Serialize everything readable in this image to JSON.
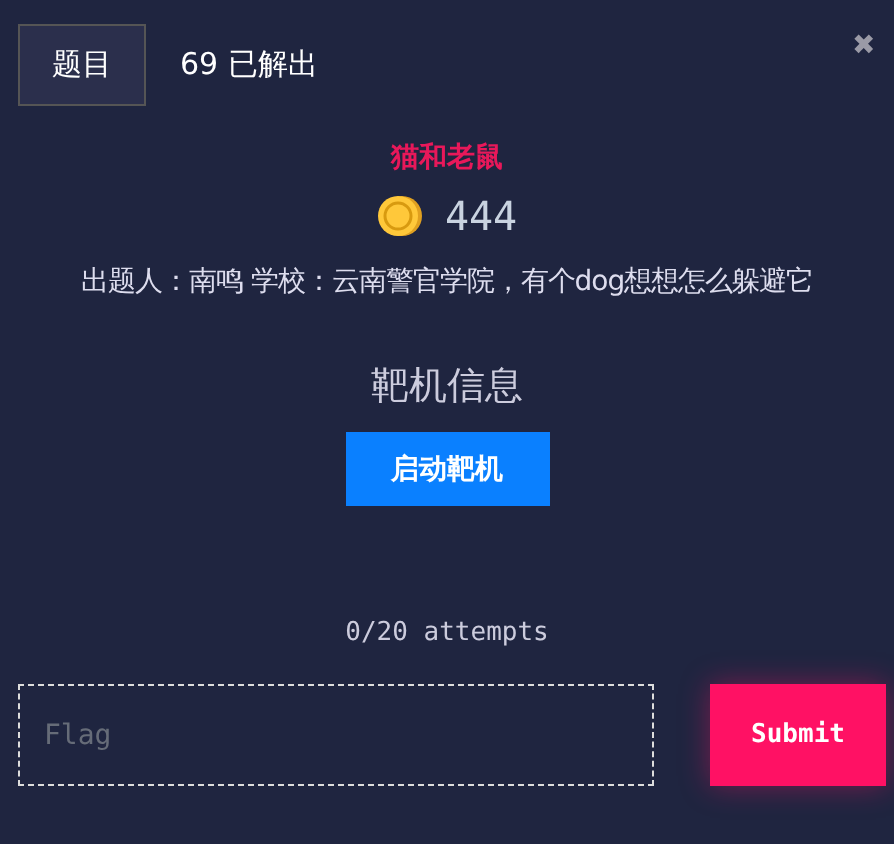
{
  "tabs": [
    {
      "label": "题目",
      "selected": true
    },
    {
      "label": "69 已解出",
      "selected": false
    }
  ],
  "close": "✖",
  "challenge": {
    "title": "猫和老鼠",
    "points": "444",
    "description": "出题人：南鸣 学校：云南警官学院，有个dog想想怎么躲避它"
  },
  "target": {
    "heading": "靶机信息",
    "button": "启动靶机"
  },
  "attempts": "0/20 attempts",
  "flag": {
    "placeholder": "Flag",
    "button": "Submit"
  }
}
